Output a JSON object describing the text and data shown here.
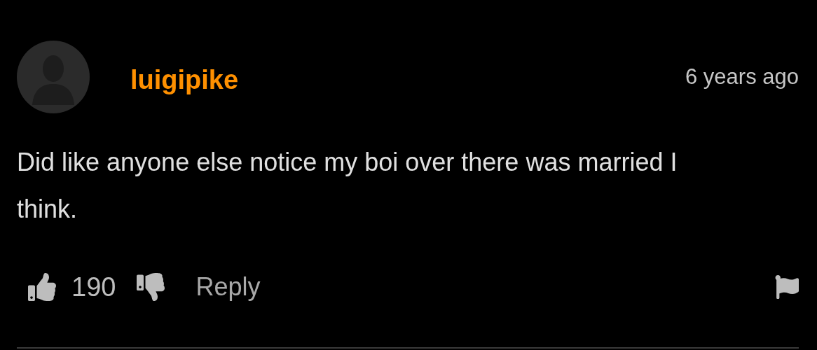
{
  "comment": {
    "author": "luigipike",
    "time": "6 years ago",
    "text": "Did like anyone else notice my boi over there was married I think.",
    "likes": "190",
    "reply_label": "Reply"
  }
}
